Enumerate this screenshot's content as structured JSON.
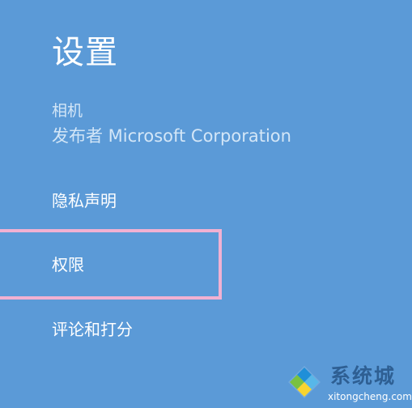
{
  "settings": {
    "title": "设置",
    "app_name": "相机",
    "publisher": "发布者 Microsoft Corporation",
    "menu": {
      "privacy": "隐私声明",
      "permissions": "权限",
      "rate_review": "评论和打分"
    }
  },
  "colors": {
    "background": "#5b9ad7",
    "highlight": "#f1b1d2"
  },
  "watermark": {
    "title": "系统城",
    "url": "xitongcheng.com",
    "logo_icon": "diamond-logo-icon"
  }
}
